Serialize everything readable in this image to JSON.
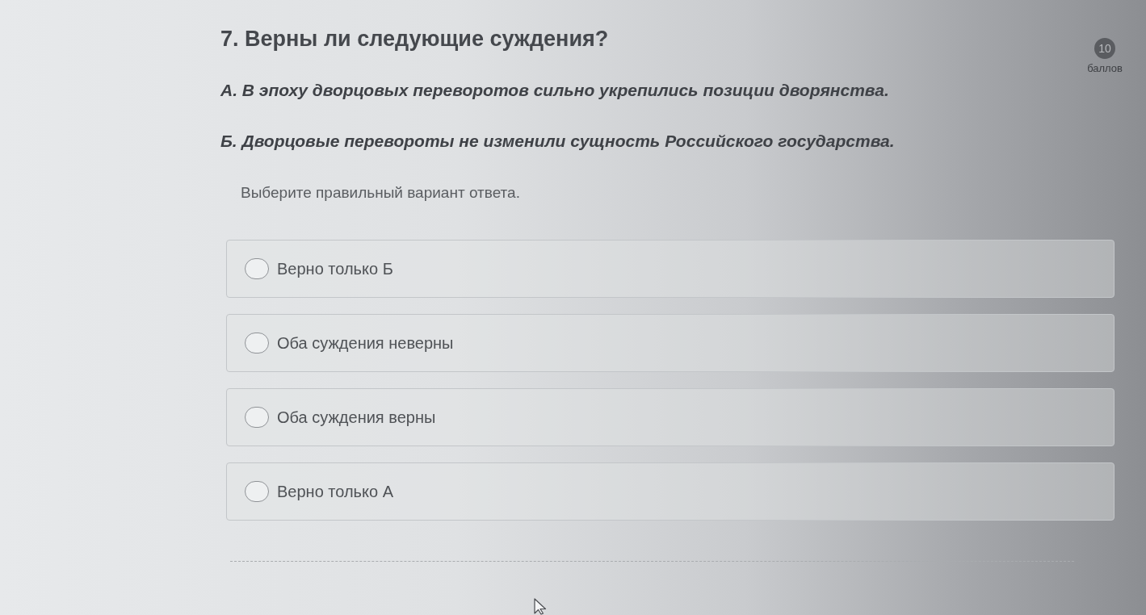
{
  "question": {
    "title": "7. Верны ли следующие суждения?",
    "points": {
      "value": "10",
      "label": "баллов"
    },
    "statements": [
      "А. В эпоху дворцовых переворотов сильно укрепились позиции дворянства.",
      "Б. Дворцовые перевороты не изменили сущность Российского государства."
    ],
    "instruction": "Выберите правильный вариант ответа.",
    "options": [
      {
        "label": "Верно только Б",
        "selected": false
      },
      {
        "label": "Оба суждения неверны",
        "selected": false
      },
      {
        "label": "Оба суждения верны",
        "selected": false
      },
      {
        "label": "Верно только А",
        "selected": false
      }
    ]
  }
}
